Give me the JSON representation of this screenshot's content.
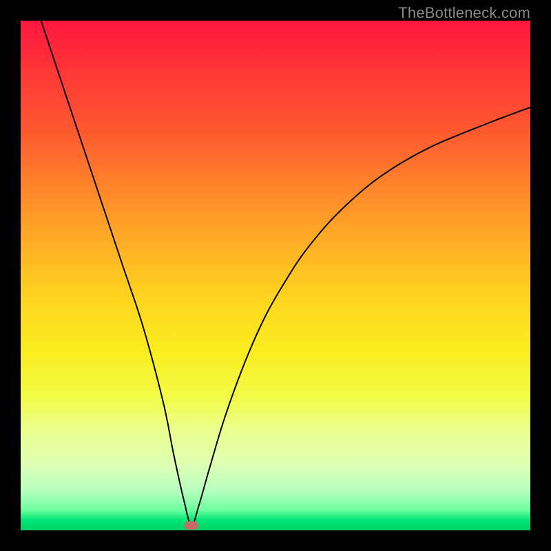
{
  "watermark": "TheBottleneck.com",
  "chart_data": {
    "type": "line",
    "title": "",
    "xlabel": "",
    "ylabel": "",
    "xlim": [
      0,
      100
    ],
    "ylim": [
      0,
      100
    ],
    "series": [
      {
        "name": "curve",
        "x": [
          4,
          8,
          12,
          16,
          20,
          24,
          28,
          30,
          32,
          33.5,
          35,
          37,
          40,
          44,
          48,
          52,
          56,
          62,
          70,
          80,
          92,
          100
        ],
        "values": [
          100,
          88,
          76,
          64,
          52,
          40,
          25,
          15,
          6,
          1,
          5,
          12,
          22,
          33,
          42,
          49,
          55,
          62,
          69,
          75,
          80,
          83
        ]
      }
    ],
    "marker": {
      "x": 33.5,
      "y": 1
    }
  },
  "colors": {
    "curve": "#000000",
    "marker": "#c96a6a"
  }
}
